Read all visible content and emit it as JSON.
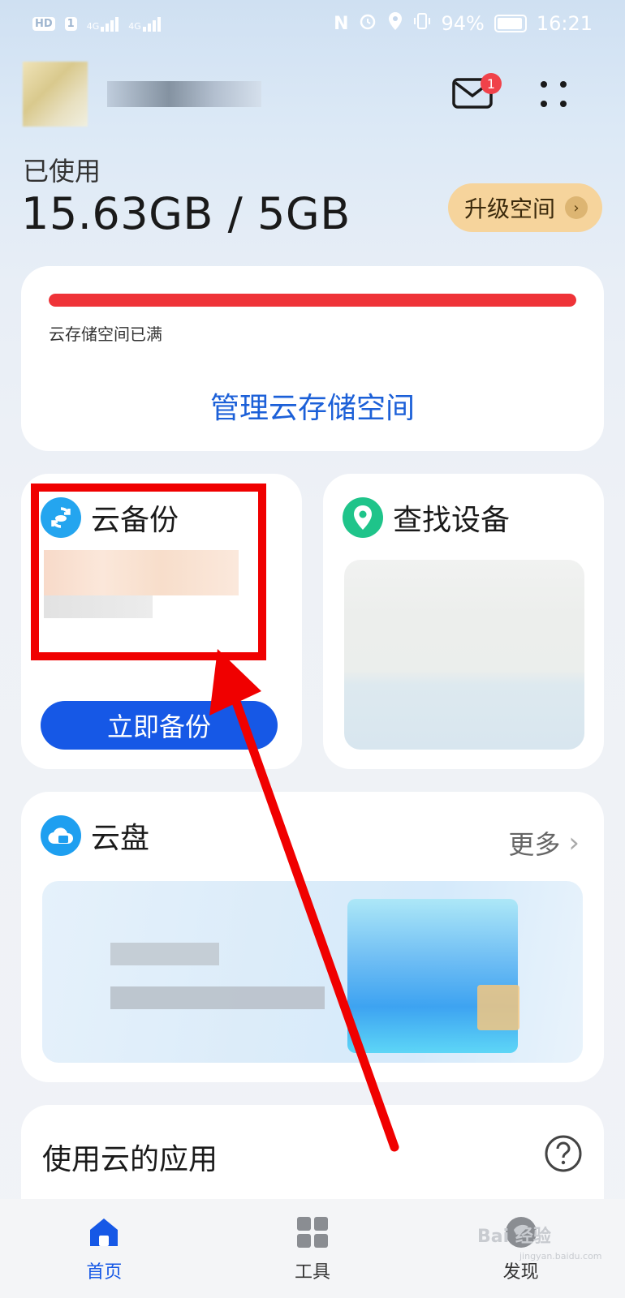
{
  "status_bar": {
    "hd_badge": "HD",
    "sim1_badge": "1",
    "net1": "4G",
    "net2": "4G",
    "battery_text": "94%",
    "time": "16:21"
  },
  "header": {
    "mail_badge_count": "1"
  },
  "storage": {
    "used_label": "已使用",
    "used_value": "15.63GB / 5GB",
    "upgrade_label": "升级空间",
    "status_text": "云存储空间已满",
    "usage_fraction": 1.0,
    "bar_color": "#ef3338",
    "manage_link": "管理云存储空间"
  },
  "backup_card": {
    "title": "云备份",
    "button_label": "立即备份"
  },
  "find_card": {
    "title": "查找设备"
  },
  "drive_card": {
    "title": "云盘",
    "more_label": "更多"
  },
  "apps_card": {
    "title": "使用云的应用"
  },
  "bottom_nav": {
    "items": [
      {
        "label": "首页",
        "icon": "home-icon",
        "active": true
      },
      {
        "label": "工具",
        "icon": "grid-icon",
        "active": false
      },
      {
        "label": "发现",
        "icon": "discover-icon",
        "active": false
      }
    ]
  },
  "watermark": {
    "text": "Bai 经验",
    "subtext": "jingyan.baidu.com"
  },
  "colors": {
    "accent": "#1658e6",
    "link": "#1c60d8",
    "annotation_red": "#f00000",
    "upgrade_bg": "#f6d49c"
  }
}
